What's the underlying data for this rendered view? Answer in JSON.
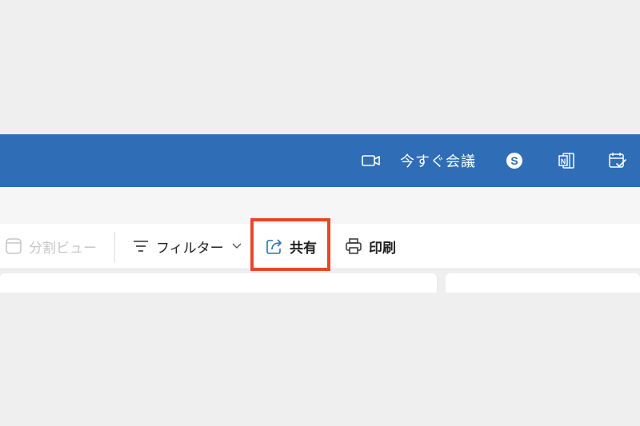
{
  "header": {
    "meet_now_label": "今すぐ会議",
    "icons": [
      "video-camera-icon",
      "skype-icon",
      "onenote-icon",
      "calendar-check-icon"
    ],
    "background_color": "#2f6db6"
  },
  "toolbar": {
    "split_view_label": "分割ビュー",
    "filter_label": "フィルター",
    "share_label": "共有",
    "print_label": "印刷",
    "highlight_color": "#e8462b",
    "accent_icon_color": "#2f6db6"
  }
}
